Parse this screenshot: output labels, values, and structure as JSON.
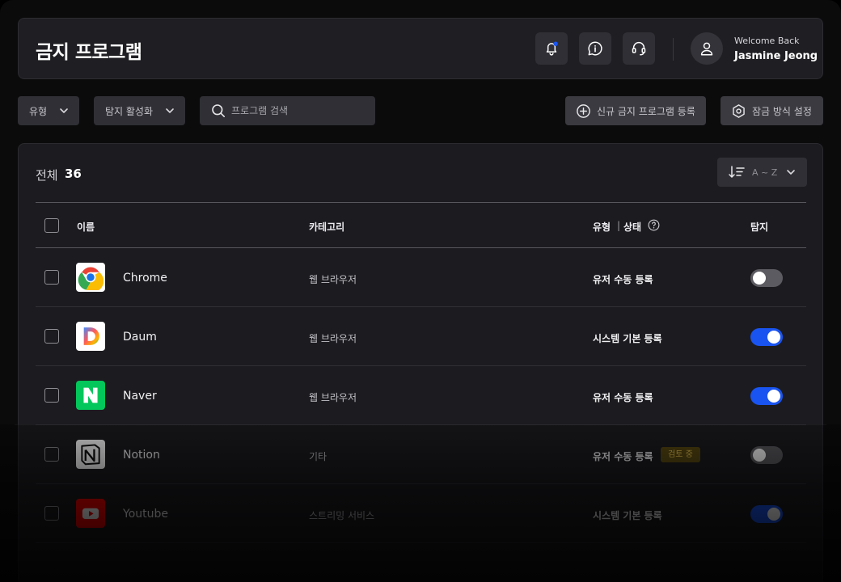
{
  "header": {
    "title": "금지 프로그램",
    "welcome": "Welcome Back",
    "user_name": "Jasmine Jeong"
  },
  "colors": {
    "accent": "#1a54f0",
    "notification_dot": "#1a54f0",
    "review_badge_bg": "#5a4a12",
    "review_badge_text": "#e4c14e"
  },
  "toolbar": {
    "type_filter": "유형",
    "detect_filter": "탐지 활성화",
    "search_placeholder": "프로그램 검색",
    "register_button": "신규 금지 프로그램 등록",
    "lock_button": "잠금 방식 설정"
  },
  "list": {
    "total_label": "전체",
    "total_count": "36",
    "sort_label": "A ~ Z",
    "columns": {
      "name": "이름",
      "category": "카테고리",
      "type": "유형",
      "status": "상태",
      "detect": "탐지"
    },
    "rows": [
      {
        "name": "Chrome",
        "icon": "chrome-icon",
        "category": "웹 브라우저",
        "type": "유저 수동 등록",
        "badge": "",
        "detect": false
      },
      {
        "name": "Daum",
        "icon": "daum-icon",
        "category": "웹 브라우저",
        "type": "시스템 기본 등록",
        "badge": "",
        "detect": true
      },
      {
        "name": "Naver",
        "icon": "naver-icon",
        "category": "웹 브라우저",
        "type": "유저 수동 등록",
        "badge": "",
        "detect": true
      },
      {
        "name": "Notion",
        "icon": "notion-icon",
        "category": "기타",
        "type": "유저 수동 등록",
        "badge": "검토 중",
        "detect": false
      },
      {
        "name": "Youtube",
        "icon": "youtube-icon",
        "category": "스트리밍 서비스",
        "type": "시스템 기본 등록",
        "badge": "",
        "detect": true
      }
    ]
  }
}
